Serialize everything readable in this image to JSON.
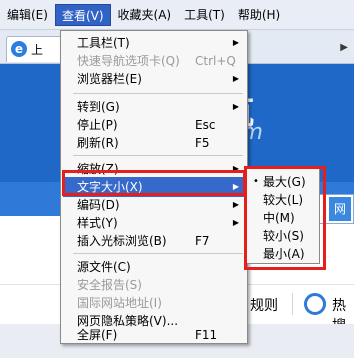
{
  "menubar": {
    "items": [
      {
        "label": "编辑(E)"
      },
      {
        "label": "查看(V)"
      },
      {
        "label": "收藏夹(A)"
      },
      {
        "label": "工具(T)"
      },
      {
        "label": "帮助(H)"
      }
    ]
  },
  "tab": {
    "title": "上"
  },
  "page": {
    "banner_big": "航",
    "banner_small": "om",
    "search_btn": "网",
    "rule_text": "规则",
    "hot_text": "热搜"
  },
  "view_menu": {
    "items": [
      {
        "label": "工具栏(T)",
        "shortcut": "",
        "submenu": true
      },
      {
        "label": "快速导航选项卡(Q)",
        "shortcut": "Ctrl+Q",
        "disabled": true
      },
      {
        "label": "浏览器栏(E)",
        "shortcut": "",
        "submenu": true
      },
      {
        "label": "转到(G)",
        "shortcut": "",
        "submenu": true
      },
      {
        "label": "停止(P)",
        "shortcut": "Esc"
      },
      {
        "label": "刷新(R)",
        "shortcut": "F5"
      },
      {
        "label": "缩放(Z)",
        "shortcut": "",
        "submenu": true
      },
      {
        "label": "文字大小(X)",
        "shortcut": "",
        "submenu": true,
        "highlighted": true
      },
      {
        "label": "编码(D)",
        "shortcut": "",
        "submenu": true
      },
      {
        "label": "样式(Y)",
        "shortcut": "",
        "submenu": true
      },
      {
        "label": "插入光标浏览(B)",
        "shortcut": "F7"
      },
      {
        "label": "源文件(C)",
        "shortcut": ""
      },
      {
        "label": "安全报告(S)",
        "shortcut": "",
        "disabled": true
      },
      {
        "label": "国际网站地址(I)",
        "shortcut": "",
        "disabled": true
      },
      {
        "label": "网页隐私策略(V)...",
        "shortcut": ""
      },
      {
        "label": "全屏(F)",
        "shortcut": "F11"
      }
    ]
  },
  "text_size_menu": {
    "items": [
      {
        "label": "最大(G)",
        "selected": true
      },
      {
        "label": "较大(L)"
      },
      {
        "label": "中(M)"
      },
      {
        "label": "较小(S)"
      },
      {
        "label": "最小(A)"
      }
    ],
    "selected_marker": "•"
  },
  "colors": {
    "highlight": "#3669c9",
    "annotation": "#e51e1e"
  }
}
